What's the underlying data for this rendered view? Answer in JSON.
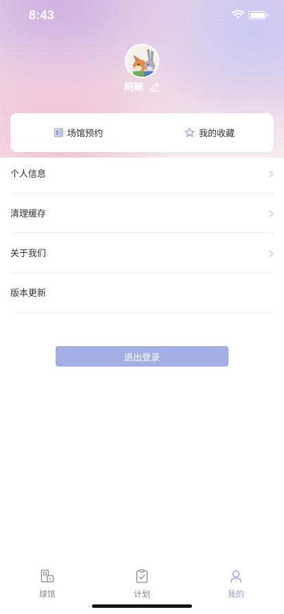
{
  "status_bar": {
    "time": "8:43",
    "signal_dots": "...."
  },
  "profile": {
    "username": "阿瞅"
  },
  "quick_actions": [
    {
      "label": "场馆预约",
      "icon": "grid-icon"
    },
    {
      "label": "我的收藏",
      "icon": "star-icon"
    }
  ],
  "menu": [
    {
      "label": "个人信息",
      "has_chevron": true
    },
    {
      "label": "清理缓存",
      "has_chevron": true
    },
    {
      "label": "关于我们",
      "has_chevron": true
    },
    {
      "label": "版本更新",
      "has_chevron": false
    }
  ],
  "logout_label": "退出登录",
  "tabs": [
    {
      "label": "球馆",
      "icon": "venue-icon",
      "active": false
    },
    {
      "label": "计划",
      "icon": "clipboard-check-icon",
      "active": false
    },
    {
      "label": "我的",
      "icon": "person-icon",
      "active": true
    }
  ],
  "colors": {
    "accent": "#a3aee6",
    "tab_active": "#8f9ee2",
    "quick_icon": "#8f9ee2"
  }
}
